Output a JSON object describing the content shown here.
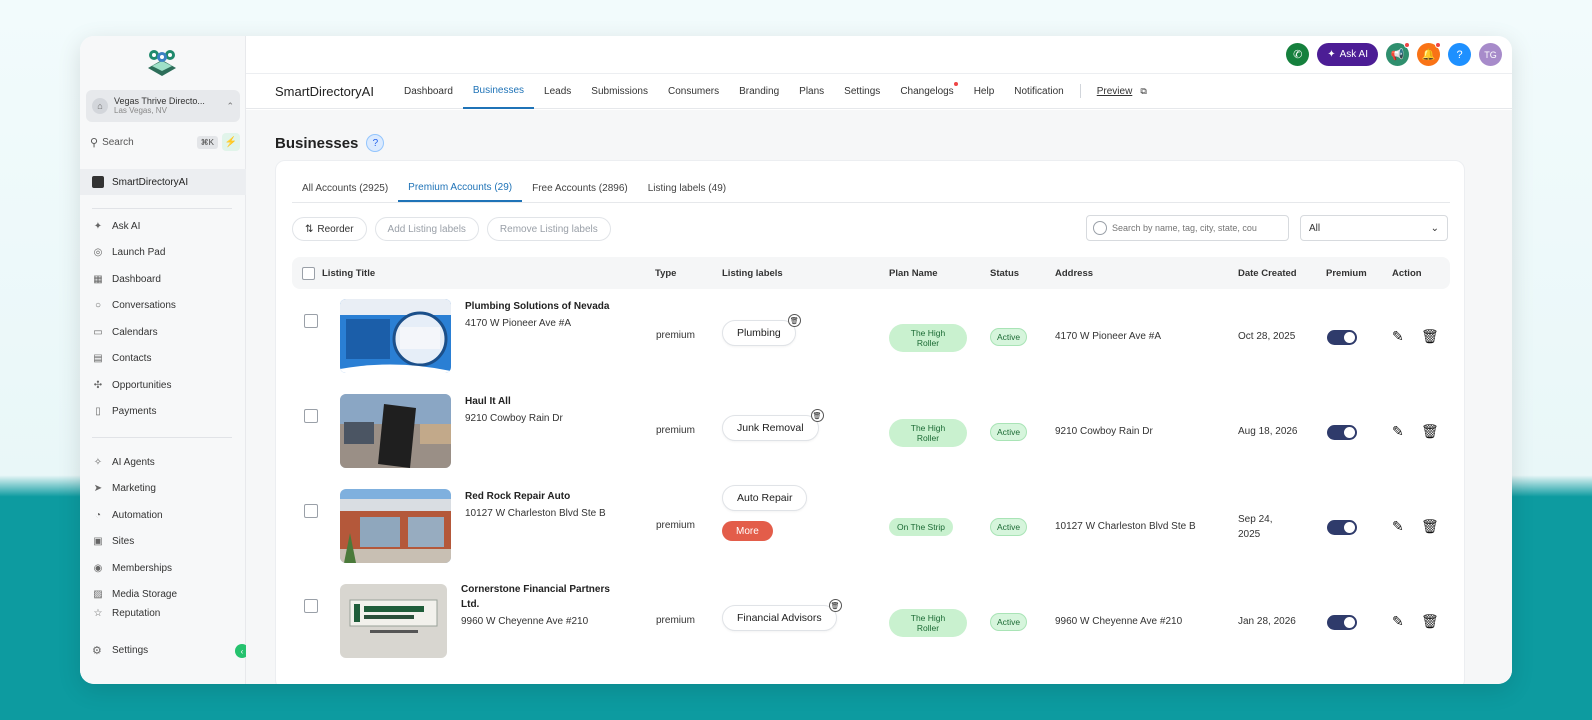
{
  "sidebar": {
    "location_name": "Vegas Thrive Directo...",
    "location_sub": "Las Vegas, NV",
    "search_label": "Search",
    "search_shortcut": "⌘K",
    "current_app": "SmartDirectoryAI",
    "items": [
      {
        "label": "Ask AI",
        "icon": "sparkle-icon"
      },
      {
        "label": "Launch Pad",
        "icon": "rocket-icon"
      },
      {
        "label": "Dashboard",
        "icon": "grid-icon"
      },
      {
        "label": "Conversations",
        "icon": "chat-icon"
      },
      {
        "label": "Calendars",
        "icon": "calendar-icon"
      },
      {
        "label": "Contacts",
        "icon": "contacts-icon"
      },
      {
        "label": "Opportunities",
        "icon": "opportunities-icon"
      },
      {
        "label": "Payments",
        "icon": "payments-icon"
      }
    ],
    "items2": [
      {
        "label": "AI Agents",
        "icon": "ai-agents-icon"
      },
      {
        "label": "Marketing",
        "icon": "send-icon"
      },
      {
        "label": "Automation",
        "icon": "automation-icon"
      },
      {
        "label": "Sites",
        "icon": "sites-icon"
      },
      {
        "label": "Memberships",
        "icon": "membership-icon"
      },
      {
        "label": "Media Storage",
        "icon": "image-icon"
      },
      {
        "label": "Reputation",
        "icon": "star-icon"
      }
    ],
    "settings_label": "Settings"
  },
  "topbar": {
    "ask_ai_label": "Ask AI",
    "avatar_initials": "TG",
    "help_label": "?"
  },
  "nav": {
    "brand": "SmartDirectoryAI",
    "tabs": [
      "Dashboard",
      "Businesses",
      "Leads",
      "Submissions",
      "Consumers",
      "Branding",
      "Plans",
      "Settings",
      "Changelogs",
      "Help",
      "Notification"
    ],
    "active_tab": "Businesses",
    "preview_label": "Preview"
  },
  "page": {
    "title": "Businesses",
    "help": "?",
    "account_tabs": [
      "All Accounts (2925)",
      "Premium Accounts (29)",
      "Free Accounts (2896)",
      "Listing labels (49)"
    ],
    "reorder_label": "Reorder",
    "add_labels_label": "Add Listing labels",
    "remove_labels_label": "Remove Listing labels",
    "search_placeholder": "Search by name, tag, city, state, cou",
    "filter_value": "All",
    "columns": {
      "title": "Listing Title",
      "type": "Type",
      "labels": "Listing labels",
      "plan": "Plan Name",
      "status": "Status",
      "address": "Address",
      "date": "Date Created",
      "premium": "Premium",
      "action": "Action"
    },
    "rows": [
      {
        "name": "Plumbing Solutions of Nevada",
        "address_line": "4170 W Pioneer Ave #A",
        "type": "premium",
        "label": "Plumbing",
        "plan_line1": "The High",
        "plan_line2": "Roller",
        "status": "Active",
        "address": "4170 W Pioneer Ave #A",
        "date": "Oct 28, 2025"
      },
      {
        "name": "Haul It All",
        "address_line": "9210 Cowboy Rain Dr",
        "type": "premium",
        "label": "Junk Removal",
        "plan_line1": "The High",
        "plan_line2": "Roller",
        "status": "Active",
        "address": "9210 Cowboy Rain Dr",
        "date": "Aug 18, 2026"
      },
      {
        "name": "Red Rock Repair Auto",
        "address_line": "10127 W Charleston Blvd Ste B",
        "type": "premium",
        "label": "Auto Repair",
        "more": "More",
        "plan_line1": "On The Strip",
        "plan_line2": "",
        "status": "Active",
        "address": "10127 W Charleston Blvd Ste B",
        "date_line1": "Sep 24,",
        "date_line2": "2025"
      },
      {
        "name_line1": "Cornerstone Financial Partners",
        "name_line2": "Ltd.",
        "address_line": "9960 W Cheyenne Ave #210",
        "type": "premium",
        "label": "Financial Advisors",
        "plan_line1": "The High",
        "plan_line2": "Roller",
        "status": "Active",
        "address": "9960 W Cheyenne Ave #210",
        "date": "Jan 28, 2026"
      }
    ]
  },
  "colors": {
    "accent": "#1f73b7",
    "status_green": "#d6f5dc",
    "more_red": "#e35d4a",
    "toggle": "#2f3b6b",
    "background_teal": "#0d9ba0"
  }
}
